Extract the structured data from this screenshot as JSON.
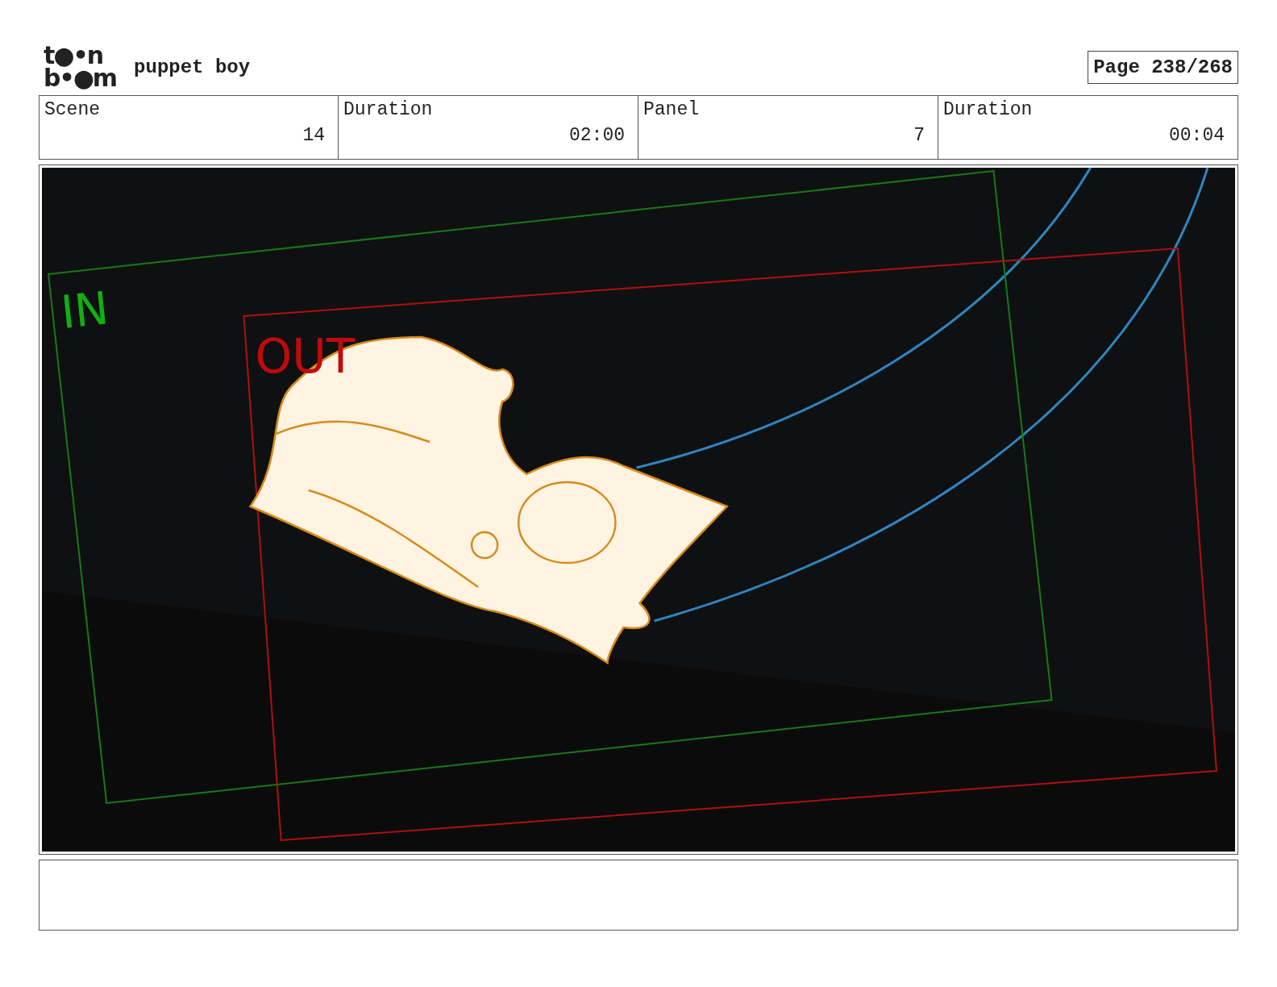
{
  "header": {
    "logo": [
      "t●•n",
      "b•●m"
    ],
    "project_title": "puppet boy",
    "page": "Page 238/268"
  },
  "info": [
    {
      "label": "Scene",
      "value": "14"
    },
    {
      "label": "Duration",
      "value": "02:00"
    },
    {
      "label": "Panel",
      "value": "7"
    },
    {
      "label": "Duration",
      "value": "00:04"
    }
  ],
  "panel": {
    "in_label": "IN",
    "out_label": "OUT"
  }
}
